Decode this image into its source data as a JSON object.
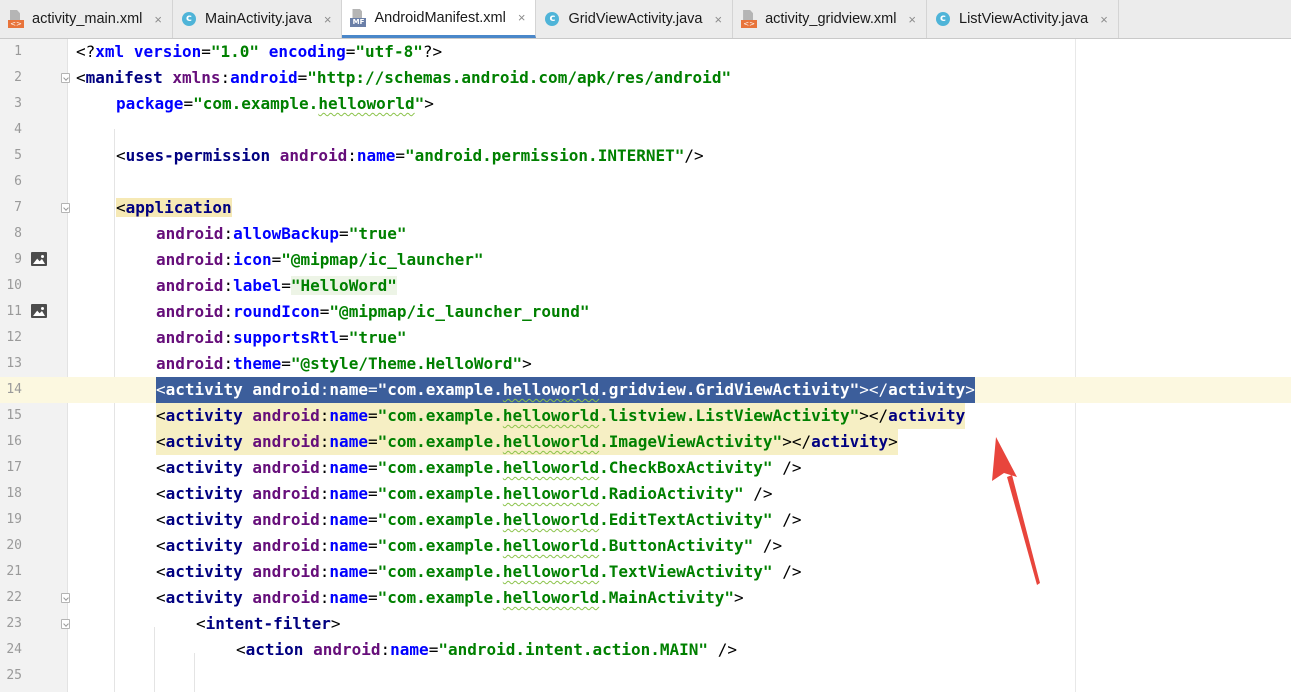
{
  "tabs": [
    {
      "label": "activity_main.xml",
      "icon": "xml-file-icon",
      "active": false
    },
    {
      "label": "MainActivity.java",
      "icon": "java-class-icon",
      "active": false
    },
    {
      "label": "AndroidManifest.xml",
      "icon": "manifest-file-icon",
      "active": true
    },
    {
      "label": "GridViewActivity.java",
      "icon": "java-class-icon",
      "active": false
    },
    {
      "label": "activity_gridview.xml",
      "icon": "xml-file-icon",
      "active": false
    },
    {
      "label": "ListViewActivity.java",
      "icon": "java-class-icon",
      "active": false
    }
  ],
  "close_glyph": "×",
  "editor": {
    "caret_line": 14,
    "selection_color": "#3c5e9b",
    "annotation_color": "#e8453c",
    "lines": [
      {
        "n": "1",
        "text": "<?xml version=\"1.0\" encoding=\"utf-8\"?>"
      },
      {
        "n": "2",
        "text": "<manifest xmlns:android=\"http://schemas.android.com/apk/res/android\""
      },
      {
        "n": "3",
        "text": "    package=\"com.example.helloworld\">"
      },
      {
        "n": "4",
        "text": ""
      },
      {
        "n": "5",
        "text": "    <uses-permission android:name=\"android.permission.INTERNET\"/>"
      },
      {
        "n": "6",
        "text": ""
      },
      {
        "n": "7",
        "text": "    <application"
      },
      {
        "n": "8",
        "text": "        android:allowBackup=\"true\""
      },
      {
        "n": "9",
        "text": "        android:icon=\"@mipmap/ic_launcher\""
      },
      {
        "n": "10",
        "text": "        android:label=\"HelloWord\""
      },
      {
        "n": "11",
        "text": "        android:roundIcon=\"@mipmap/ic_launcher_round\""
      },
      {
        "n": "12",
        "text": "        android:supportsRtl=\"true\""
      },
      {
        "n": "13",
        "text": "        android:theme=\"@style/Theme.HelloWord\">"
      },
      {
        "n": "14",
        "text": "        <activity android:name=\"com.example.helloworld.gridview.GridViewActivity\"></activity>"
      },
      {
        "n": "15",
        "text": "        <activity android:name=\"com.example.helloworld.listview.ListViewActivity\"></activity"
      },
      {
        "n": "16",
        "text": "        <activity android:name=\"com.example.helloworld.ImageViewActivity\"></activity>"
      },
      {
        "n": "17",
        "text": "        <activity android:name=\"com.example.helloworld.CheckBoxActivity\" />"
      },
      {
        "n": "18",
        "text": "        <activity android:name=\"com.example.helloworld.RadioActivity\" />"
      },
      {
        "n": "19",
        "text": "        <activity android:name=\"com.example.helloworld.EditTextActivity\" />"
      },
      {
        "n": "20",
        "text": "        <activity android:name=\"com.example.helloworld.ButtonActivity\" />"
      },
      {
        "n": "21",
        "text": "        <activity android:name=\"com.example.helloworld.TextViewActivity\" />"
      },
      {
        "n": "22",
        "text": "        <activity android:name=\"com.example.helloworld.MainActivity\">"
      },
      {
        "n": "23",
        "text": "            <intent-filter>"
      },
      {
        "n": "24",
        "text": "                <action android:name=\"android.intent.action.MAIN\" />"
      },
      {
        "n": "25",
        "text": ""
      }
    ]
  }
}
